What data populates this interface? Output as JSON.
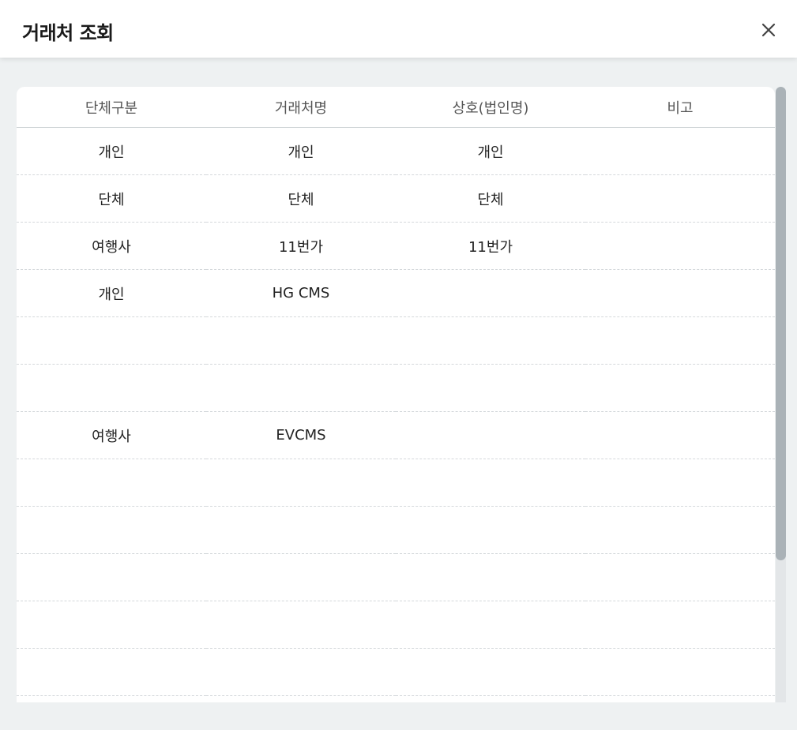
{
  "dialog": {
    "title": "거래처 조회"
  },
  "table": {
    "columns": [
      "단체구분",
      "거래처명",
      "상호(법인명)",
      "비고"
    ],
    "rows": [
      [
        "개인",
        "개인",
        "개인",
        ""
      ],
      [
        "단체",
        "단체",
        "단체",
        ""
      ],
      [
        "여행사",
        "11번가",
        "11번가",
        ""
      ],
      [
        "개인",
        "HG CMS",
        "",
        ""
      ],
      [
        "",
        "",
        "",
        ""
      ],
      [
        "",
        "",
        "",
        ""
      ],
      [
        "여행사",
        "EVCMS",
        "",
        ""
      ],
      [
        "",
        "",
        "",
        ""
      ],
      [
        "",
        "",
        "",
        ""
      ],
      [
        "",
        "",
        "",
        ""
      ],
      [
        "",
        "",
        "",
        ""
      ],
      [
        "",
        "",
        "",
        ""
      ]
    ]
  },
  "icons": {
    "close": "close-icon"
  },
  "colors": {
    "page_background": "#eef1f2",
    "header_background": "#ffffff",
    "scroll_thumb": "#aab2b7",
    "scroll_track": "#e3e6e8"
  }
}
